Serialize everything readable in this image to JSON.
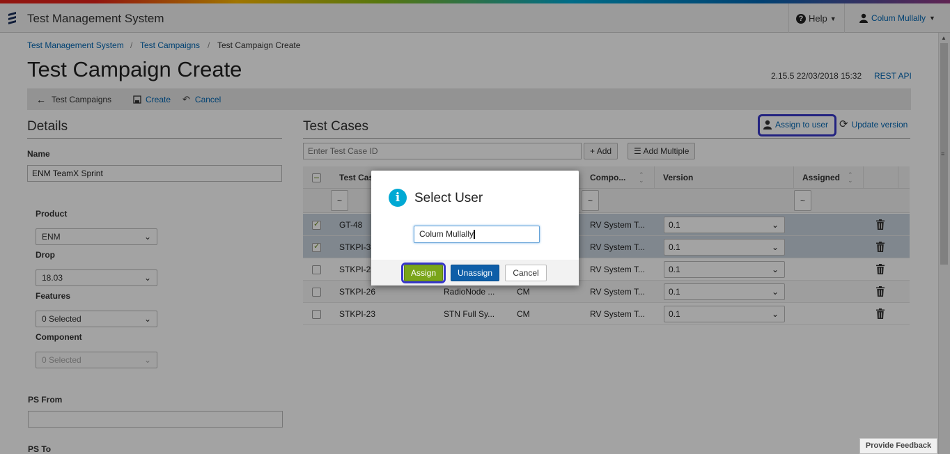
{
  "app": {
    "title": "Test Management System",
    "help_label": "Help",
    "user_name": "Colum Mullally"
  },
  "breadcrumb": [
    "Test Management System",
    "Test Campaigns",
    "Test Campaign Create"
  ],
  "page": {
    "title": "Test Campaign Create",
    "version": "2.15.5 22/03/2018 15:32",
    "rest_api": "REST API"
  },
  "actionbar": {
    "back": "Test Campaigns",
    "create": "Create",
    "cancel": "Cancel"
  },
  "details": {
    "heading": "Details",
    "name_label": "Name",
    "name_value": "ENM TeamX Sprint",
    "product_label": "Product",
    "product_value": "ENM",
    "drop_label": "Drop",
    "drop_value": "18.03",
    "features_label": "Features",
    "features_value": "0 Selected",
    "component_label": "Component",
    "component_value": "0 Selected",
    "psfrom_label": "PS From",
    "psto_label": "PS To"
  },
  "testcases": {
    "heading": "Test Cases",
    "assign_label": "Assign to user",
    "update_label": "Update version",
    "input_placeholder": "Enter Test Case ID",
    "add_label": "Add",
    "add_multiple_label": "Add Multiple",
    "columns": [
      "Test Cas",
      "Compo...",
      "Version",
      "Assigned"
    ],
    "filter_symbol": "~",
    "rows": [
      {
        "id": "GT-48",
        "title": "",
        "area": "",
        "component": "RV System T...",
        "version": "0.1",
        "checked": true
      },
      {
        "id": "STKPI-3",
        "title": "",
        "area": "",
        "component": "RV System T...",
        "version": "0.1",
        "checked": true
      },
      {
        "id": "STKPI-2",
        "title": "",
        "area": "",
        "component": "RV System T...",
        "version": "0.1",
        "checked": false
      },
      {
        "id": "STKPI-26",
        "title": "RadioNode ...",
        "area": "CM",
        "component": "RV System T...",
        "version": "0.1",
        "checked": false
      },
      {
        "id": "STKPI-23",
        "title": "STN Full Sy...",
        "area": "CM",
        "component": "RV System T...",
        "version": "0.1",
        "checked": false
      }
    ]
  },
  "modal": {
    "title": "Select User",
    "user_value": "Colum Mullally",
    "assign": "Assign",
    "unassign": "Unassign",
    "cancel": "Cancel"
  },
  "feedback": "Provide Feedback",
  "colors": {
    "link": "#0066b3",
    "assign_green": "#7aa51a",
    "unassign_blue": "#0e5ea8",
    "selected_row": "#c8d3de",
    "highlight": "#3737c8"
  }
}
